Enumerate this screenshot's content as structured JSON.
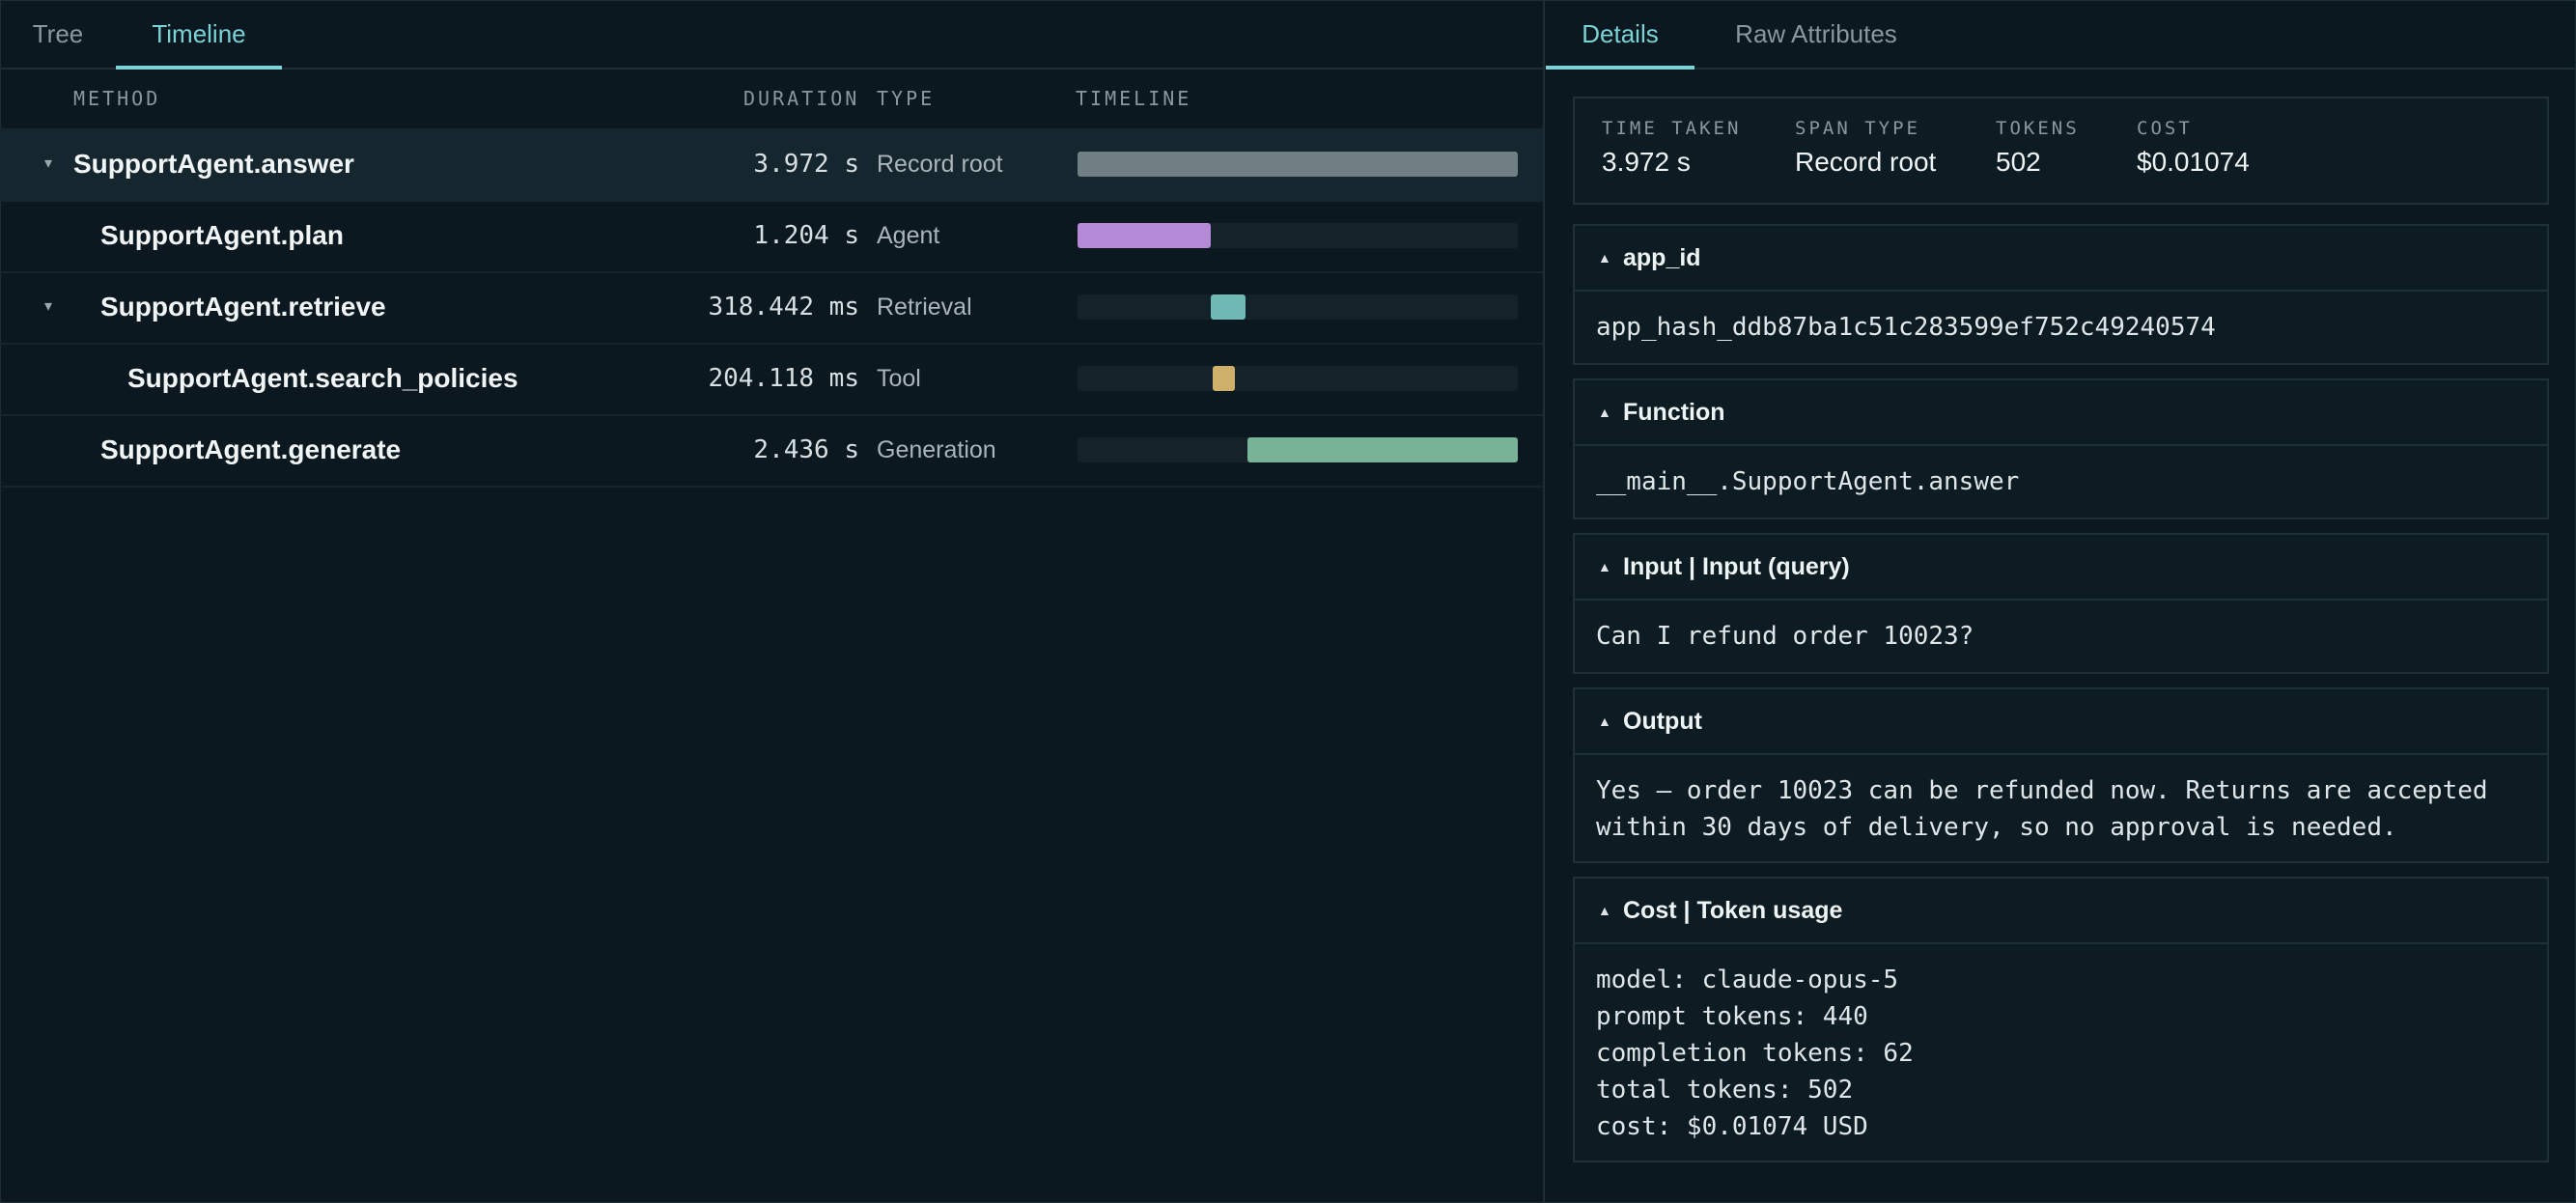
{
  "left_tabs": [
    "Tree",
    "Timeline"
  ],
  "columns": {
    "method": "METHOD",
    "duration": "DURATION",
    "type": "TYPE",
    "timeline": "TIMELINE"
  },
  "spans": [
    {
      "name": "SupportAgent.answer",
      "duration": "3.972 s",
      "type": "Record root",
      "expanded": true,
      "timeline_start_fraction": 0.0,
      "timeline_width_fraction": 1.0,
      "color": "#6f7f84"
    },
    {
      "name": "SupportAgent.plan",
      "duration": "1.204 s",
      "type": "Agent",
      "timeline_start_fraction": 0.0,
      "timeline_width_fraction": 0.303,
      "color": "#b48ad6"
    },
    {
      "name": "SupportAgent.retrieve",
      "duration": "318.442 ms",
      "type": "Retrieval",
      "expanded": true,
      "timeline_start_fraction": 0.303,
      "timeline_width_fraction": 0.08,
      "color": "#6fb8b4"
    },
    {
      "name": "SupportAgent.search_policies",
      "duration": "204.118 ms",
      "type": "Tool",
      "timeline_start_fraction": 0.307,
      "timeline_width_fraction": 0.051,
      "color": "#cfb06a"
    },
    {
      "name": "SupportAgent.generate",
      "duration": "2.436 s",
      "type": "Generation",
      "timeline_start_fraction": 0.387,
      "timeline_width_fraction": 0.613,
      "color": "#78b297"
    }
  ],
  "right_tabs": [
    "Details",
    "Raw Attributes"
  ],
  "stats": [
    {
      "label": "TIME TAKEN",
      "value": "3.972 s"
    },
    {
      "label": "SPAN TYPE",
      "value": "Record root"
    },
    {
      "label": "TOKENS",
      "value": "502"
    },
    {
      "label": "COST",
      "value": "$0.01074"
    }
  ],
  "sections": [
    {
      "title": "app_id",
      "body": "app_hash_ddb87ba1c51c283599ef752c49240574"
    },
    {
      "title": "Function",
      "body": "__main__.SupportAgent.answer"
    },
    {
      "title": "Input | Input (query)",
      "body": "Can I refund order 10023?"
    },
    {
      "title": "Output",
      "body": "Yes — order 10023 can be refunded now. Returns are accepted\nwithin 30 days of delivery, so no approval is needed."
    },
    {
      "title": "Cost | Token usage",
      "body": "model: claude-opus-5\nprompt tokens: 440\ncompletion tokens: 62\ntotal tokens: 502\ncost: $0.01074 USD"
    }
  ]
}
